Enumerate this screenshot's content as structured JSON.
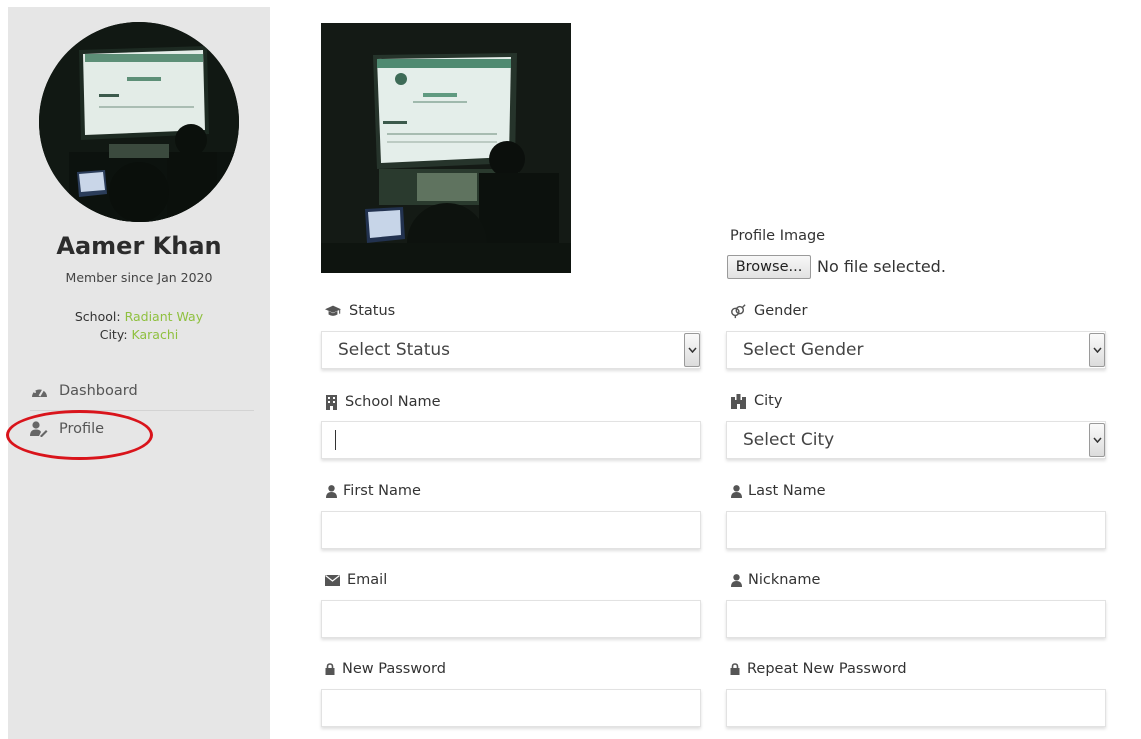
{
  "sidebar": {
    "name": "Aamer Khan",
    "member_since": "Member since Jan 2020",
    "school_label": "School:",
    "school_value": "Radiant Way",
    "city_label": "City:",
    "city_value": "Karachi",
    "nav": [
      {
        "label": "Dashboard",
        "icon": "dashboard-icon"
      },
      {
        "label": "Profile",
        "icon": "user-edit-icon"
      }
    ],
    "highlight_color": "#d9141b",
    "accent_color": "#8fc03f"
  },
  "form": {
    "profile_image_label": "Profile Image",
    "browse_label": "Browse...",
    "no_file_text": "No file selected.",
    "status": {
      "label": "Status",
      "selected": "Select Status",
      "icon": "graduation-cap-icon"
    },
    "gender": {
      "label": "Gender",
      "selected": "Select Gender",
      "icon": "gender-icon"
    },
    "school_name": {
      "label": "School Name",
      "value": "",
      "icon": "building-icon"
    },
    "city": {
      "label": "City",
      "selected": "Select City",
      "icon": "castle-icon"
    },
    "first_name": {
      "label": "First Name",
      "value": "",
      "icon": "user-icon"
    },
    "last_name": {
      "label": "Last Name",
      "value": "",
      "icon": "user-icon"
    },
    "email": {
      "label": "Email",
      "value": "",
      "icon": "envelope-icon"
    },
    "nickname": {
      "label": "Nickname",
      "value": "",
      "icon": "user-icon"
    },
    "new_password": {
      "label": "New Password",
      "value": "",
      "icon": "lock-icon"
    },
    "repeat_password": {
      "label": "Repeat New Password",
      "value": "",
      "icon": "lock-icon"
    }
  }
}
